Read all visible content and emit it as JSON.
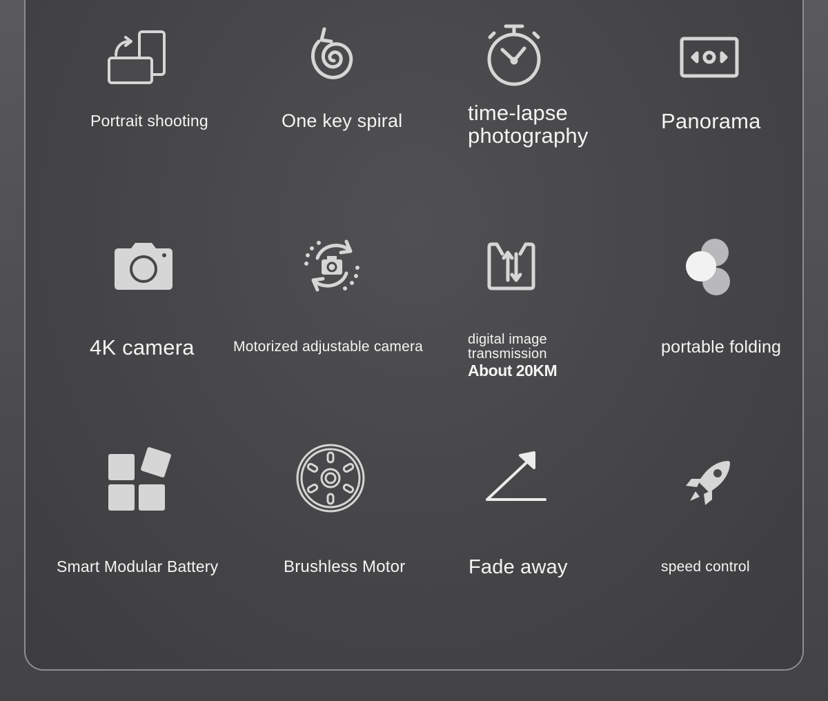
{
  "features": [
    {
      "label": "Portrait shooting",
      "icon": "rotate-screen-icon"
    },
    {
      "label": "One key spiral",
      "icon": "spiral-icon"
    },
    {
      "label": "time-lapse photography",
      "icon": "stopwatch-icon"
    },
    {
      "label": "Panorama",
      "icon": "panorama-icon"
    },
    {
      "label": "4K camera",
      "icon": "camera-icon"
    },
    {
      "label": "Motorized adjustable camera",
      "icon": "rotate-camera-icon"
    },
    {
      "label": "digital image transmission",
      "sub": "About 20KM",
      "icon": "signal-transmission-icon"
    },
    {
      "label": "portable folding",
      "icon": "folding-circles-icon"
    },
    {
      "label": "Smart Modular Battery",
      "icon": "modular-blocks-icon"
    },
    {
      "label": "Brushless Motor",
      "icon": "brushless-motor-icon"
    },
    {
      "label": "Fade away",
      "icon": "fade-away-arrow-icon"
    },
    {
      "label": "speed control",
      "icon": "rocket-icon"
    }
  ],
  "colors": {
    "background": "#4b4b4d",
    "icon": "#d8d8d8",
    "text": "#f4f4f4",
    "border": "#8e8e90"
  }
}
